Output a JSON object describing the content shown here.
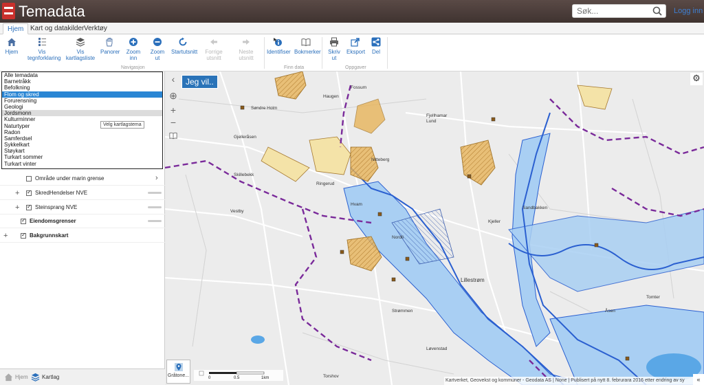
{
  "app": {
    "title": "Temadata"
  },
  "search": {
    "placeholder": "Søk...",
    "value": ""
  },
  "header": {
    "login_label": "Logg inn"
  },
  "tabs": [
    {
      "label": "Hjem",
      "active": true
    },
    {
      "label": "Kart og datakilder",
      "active": false
    },
    {
      "label": "Verktøy",
      "active": false
    }
  ],
  "ribbon": {
    "navigasjon": {
      "group_label": "Navigasjon",
      "hjem": "Hjem",
      "vis_tegnforklaring": "Vis tegnforklaring",
      "vis_kartlagsliste": "Vis kartlagsliste",
      "panorer": "Panorer",
      "zoom_inn": "Zoom inn",
      "zoom_ut": "Zoom ut",
      "startutsnitt": "Startutsnitt",
      "forrige_utsnitt": "Forrige utsnitt",
      "neste_utsnitt": "Neste utsnitt"
    },
    "finn_data": {
      "group_label": "Finn data",
      "identifiser": "Identifiser",
      "bokmerker": "Bokmerker"
    },
    "oppgaver": {
      "group_label": "Oppgaver",
      "skriv_ut": "Skriv ut",
      "eksport": "Eksport",
      "del": "Del"
    }
  },
  "theme_list": {
    "items": [
      "Alle temadata",
      "Barnetråkk",
      "Befolkning",
      "Flom og skred",
      "Forurensning",
      "Geologi",
      "Jordsmonn",
      "Kulturminner",
      "Naturtyper",
      "Radon",
      "Samferdsel",
      "Sykkelkart",
      "Støykart",
      "Turkart sommer",
      "Turkart vinter"
    ],
    "selected": "Flom og skred",
    "hovered": "Jordsmonn",
    "tooltip": "Velg kartlagstema"
  },
  "layers": [
    {
      "label": "Område under marin grense",
      "checked": false
    },
    {
      "label": "SkredHendelser NVE",
      "checked": true
    },
    {
      "label": "Steinsprang NVE",
      "checked": true
    },
    {
      "label": "Eiendomsgrenser",
      "checked": true
    },
    {
      "label": "Bakgrunnskart",
      "checked": true
    }
  ],
  "bottom_tabs": [
    {
      "label": "Hjem"
    },
    {
      "label": "Kartlag"
    }
  ],
  "map": {
    "jeg_vil": "Jeg vil..",
    "basemap_label": "Gråtone...",
    "scale_labels": [
      "0",
      "0.5",
      "1km"
    ],
    "attribution": "Kartverket, Geovekst og kommuner - Geodata AS | None | Publisert på nytt 8. februrara 2016 etter endring av sy",
    "place_names": [
      "Fossum",
      "Haugen",
      "Hvam",
      "Lillestrøm",
      "Løvenstad",
      "Strømmen",
      "Nitteberg",
      "Skillebekk",
      "Vestby",
      "Fjellhamar",
      "Kjeller",
      "Torshov",
      "Lund",
      "Åsen",
      "Gjelleråsen",
      "Ringerud",
      "Søndre Holm",
      "Nordli",
      "Tomter",
      "Sandbakken"
    ],
    "colors": {
      "water": "#5aa7e6",
      "flood": "#a9cff3",
      "hazard": "#e8b45a",
      "boundary": "#7a2a9a",
      "road": "#ffffff"
    }
  }
}
